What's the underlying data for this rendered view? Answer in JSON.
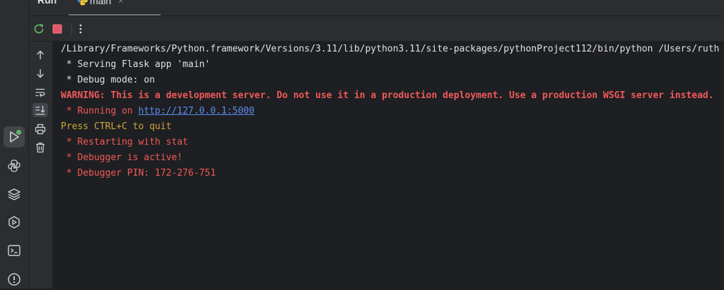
{
  "tool_window": {
    "title": "Run",
    "tab": {
      "label": "main",
      "icon": "python-icon",
      "close": "×"
    }
  },
  "toolbar": {
    "rerun_icon": "rerun-icon",
    "stop_icon": "stop-icon",
    "more_icon": "more-vertical-icon"
  },
  "activity_bar": [
    "run-icon",
    "python-console-icon",
    "layers-icon",
    "services-icon",
    "terminal-icon",
    "problems-icon"
  ],
  "side_toolbar": [
    "arrow-up-icon",
    "arrow-down-icon",
    "soft-wrap-icon",
    "scroll-to-end-icon",
    "print-icon",
    "trash-icon"
  ],
  "colors": {
    "text": "#dfe1e5",
    "warning": "#f05a5a",
    "stderr": "#f05a5a",
    "system": "#cda739",
    "link": "#5c8cf0",
    "status_ok": "#5fb865"
  },
  "console": {
    "command": "/Library/Frameworks/Python.framework/Versions/3.11/lib/python3.11/site-packages/pythonProject112/bin/python /Users/ruth",
    "serving": " * Serving Flask app 'main'",
    "debug_mode": " * Debug mode: on",
    "warning": "WARNING: This is a development server. Do not use it in a production deployment. Use a production WSGI server instead.",
    "running_prefix": " * Running on ",
    "running_url": "http://127.0.0.1:5000",
    "quit": "Press CTRL+C to quit",
    "restarting": " * Restarting with stat",
    "debugger_active": " * Debugger is active!",
    "debugger_pin": " * Debugger PIN: 172-276-751"
  }
}
